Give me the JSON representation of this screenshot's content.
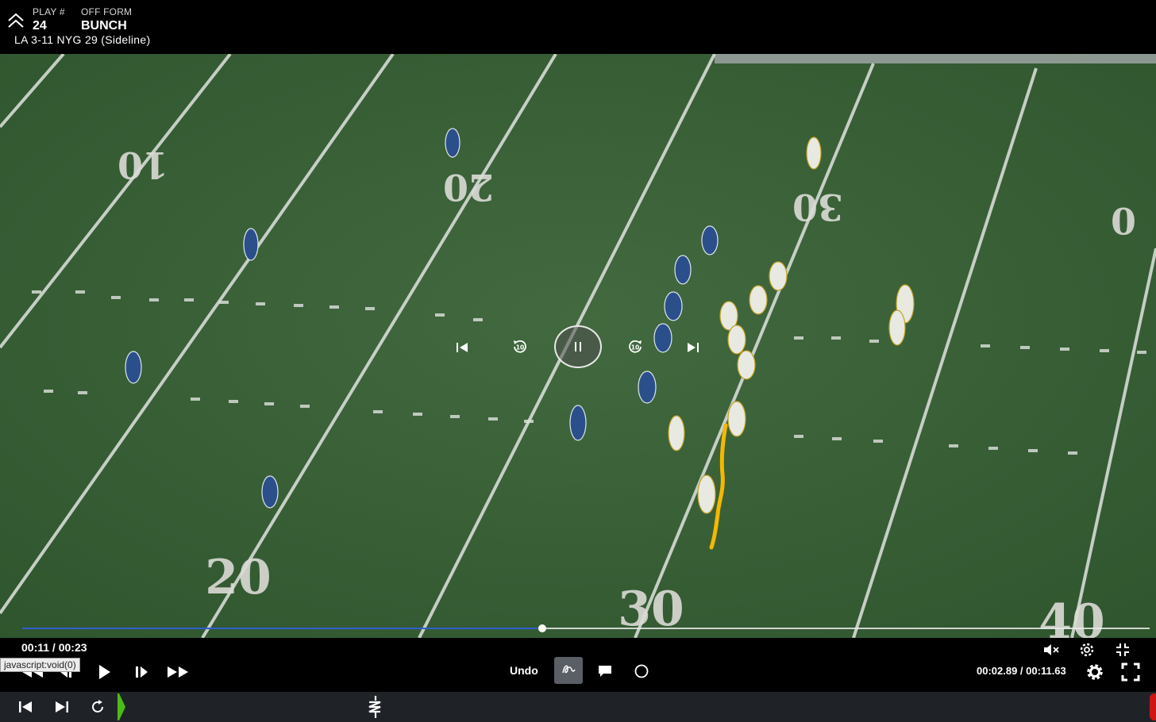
{
  "header": {
    "play_label": "PLAY #",
    "play_value": "24",
    "form_label": "OFF FORM",
    "form_value": "BUNCH",
    "situation": "LA  3-11  NYG 29 (Sideline)"
  },
  "field": {
    "yard_numbers": [
      "10",
      "20",
      "30",
      "0",
      "20",
      "30",
      "40"
    ],
    "drawing_color": "#f5b800",
    "field_color": "#3b6339"
  },
  "player": {
    "progress_fraction": 0.461,
    "pause_icon": "pause-icon"
  },
  "controls": {
    "time": "00:11 / 00:23",
    "tooltip": "javascript:void(0)",
    "undo_label": "Undo",
    "segment_time": "00:02.89 / 00:11.63"
  },
  "colors": {
    "scrub_fill": "#2f5fd0",
    "active_tool_bg": "#5a5f66",
    "strip_bg": "#1f2327",
    "strip_start": "#4cbb17",
    "strip_end": "#d01414"
  }
}
